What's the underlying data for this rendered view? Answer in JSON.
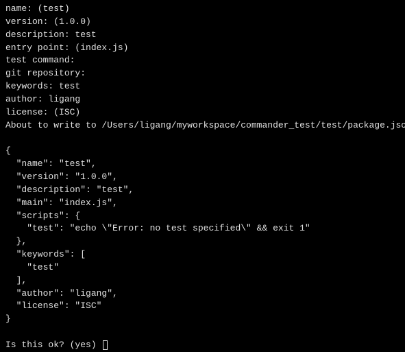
{
  "prompts": {
    "name": "name: (test)",
    "version": "version: (1.0.0)",
    "description": "description: test",
    "entry_point": "entry point: (index.js)",
    "test_command": "test command:",
    "git_repository": "git repository:",
    "keywords": "keywords: test",
    "author": "author: ligang",
    "license": "license: (ISC)"
  },
  "about_to_write": "About to write to /Users/ligang/myworkspace/commander_test/test/package.json:",
  "blank": "",
  "json_lines": {
    "l0": "{",
    "l1": "  \"name\": \"test\",",
    "l2": "  \"version\": \"1.0.0\",",
    "l3": "  \"description\": \"test\",",
    "l4": "  \"main\": \"index.js\",",
    "l5": "  \"scripts\": {",
    "l6": "    \"test\": \"echo \\\"Error: no test specified\\\" && exit 1\"",
    "l7": "  },",
    "l8": "  \"keywords\": [",
    "l9": "    \"test\"",
    "l10": "  ],",
    "l11": "  \"author\": \"ligang\",",
    "l12": "  \"license\": \"ISC\"",
    "l13": "}"
  },
  "confirm": "Is this ok? (yes) "
}
